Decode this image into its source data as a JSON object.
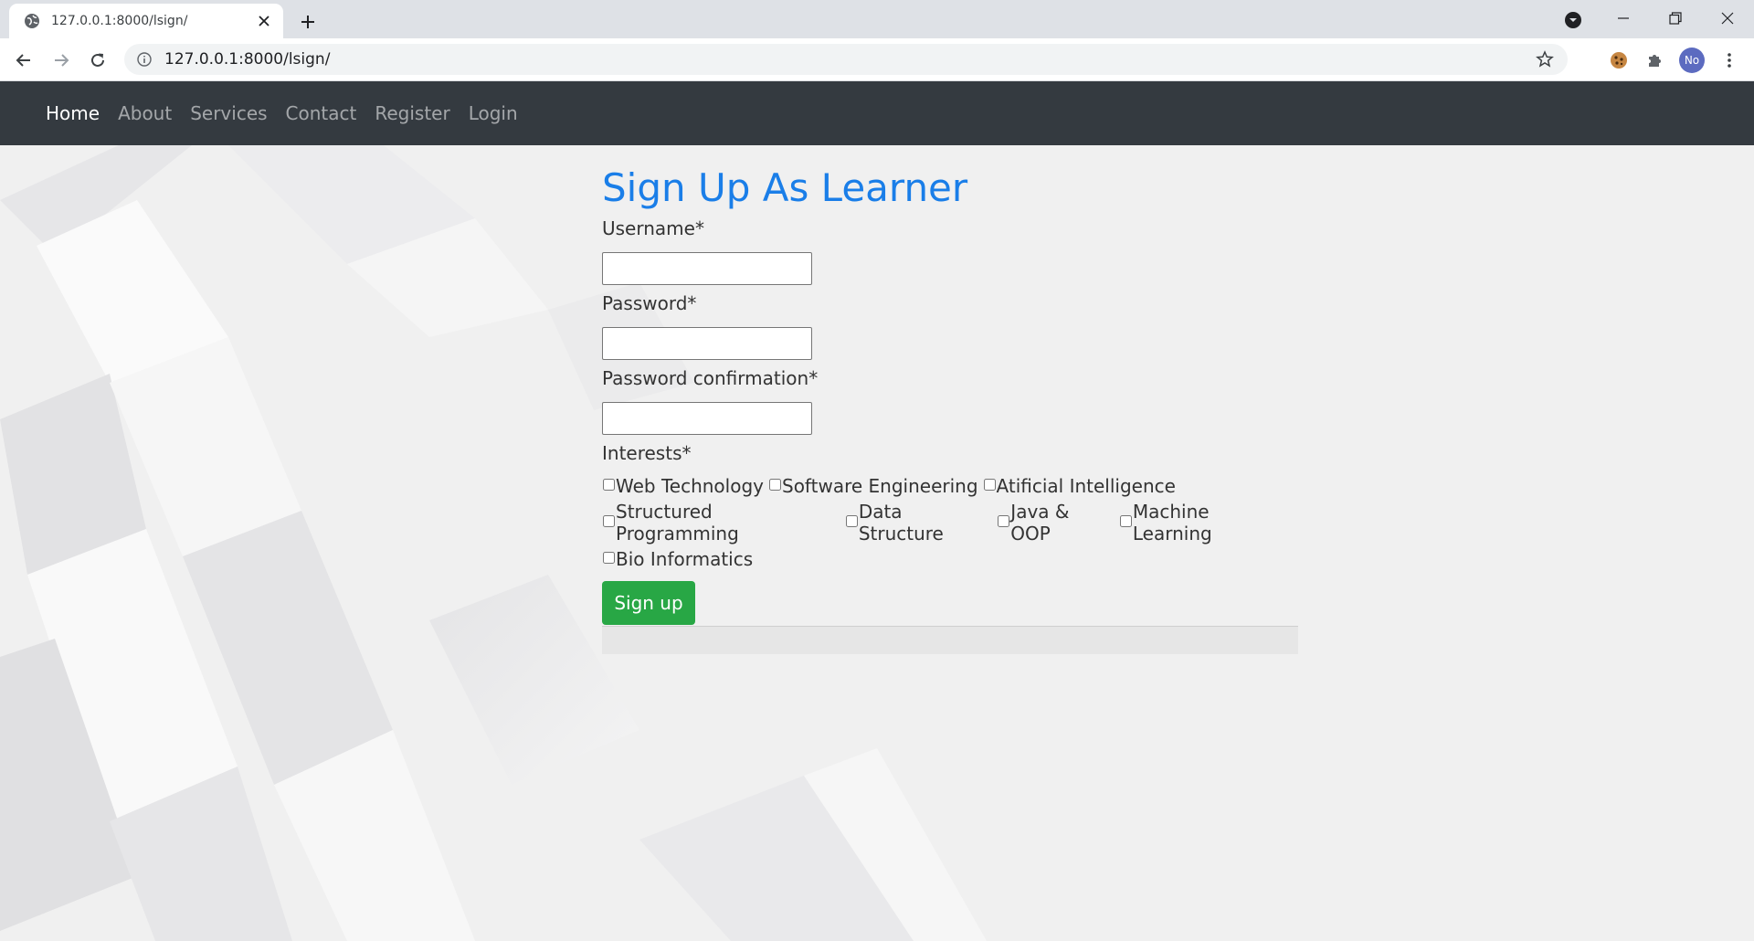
{
  "browser": {
    "tab_title": "127.0.0.1:8000/lsign/",
    "url": "127.0.0.1:8000/lsign/",
    "profile_initials": "No"
  },
  "nav": {
    "links": [
      "Home",
      "About",
      "Services",
      "Contact",
      "Register",
      "Login"
    ],
    "active": "Home"
  },
  "form": {
    "title": "Sign Up As Learner",
    "username_label": "Username*",
    "password_label": "Password*",
    "password_confirm_label": "Password confirmation*",
    "interests_label": "Interests*",
    "interests": [
      "Web Technology",
      "Software Engineering",
      "Atificial Intelligence",
      "Structured Programming",
      "Data Structure",
      "Java & OOP",
      "Machine Learning",
      "Bio Informatics"
    ],
    "submit_label": "Sign up"
  },
  "colors": {
    "navbar_bg": "#343a40",
    "title": "#1a7ee8",
    "submit_bg": "#28a745"
  }
}
